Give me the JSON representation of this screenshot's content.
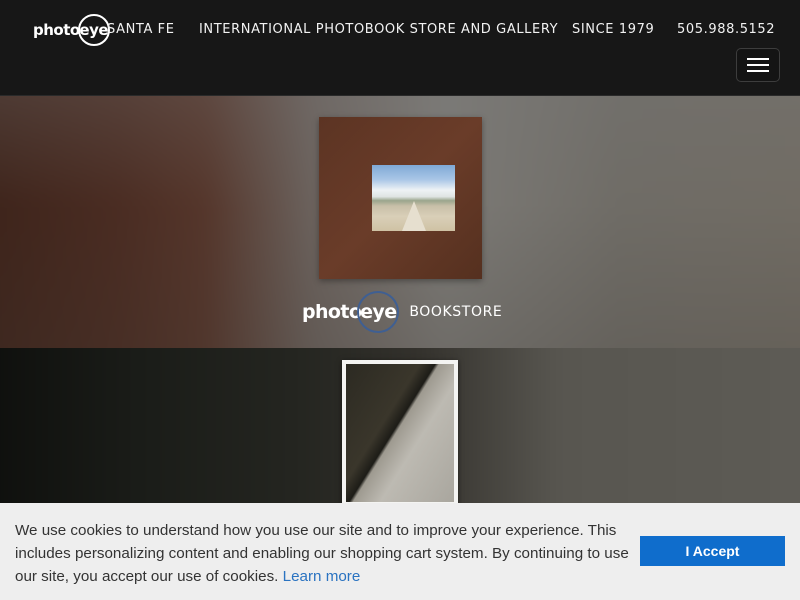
{
  "header": {
    "logo_text_left": "photo",
    "logo_text_eye": "eye",
    "location": "SANTA FE",
    "tagline": "INTERNATIONAL PHOTOBOOK STORE AND GALLERY",
    "since": "SINCE 1979",
    "phone": "505.988.5152",
    "menu_icon": "hamburger-icon"
  },
  "hero": {
    "brand_left": "photo",
    "brand_eye": "eye",
    "section_label": "BOOKSTORE"
  },
  "cookie": {
    "message": "We use cookies to understand how you use our site and to improve your experience. This includes personalizing content and enabling our shopping cart system. By continuing to use our site, you accept our use of cookies.",
    "link_text": "Learn more",
    "accept_label": "I Accept"
  },
  "colors": {
    "header_bg": "#171717",
    "accent_blue": "#0f6dcc",
    "link_blue": "#2a73c1",
    "cookie_bg": "#eeeeee"
  }
}
